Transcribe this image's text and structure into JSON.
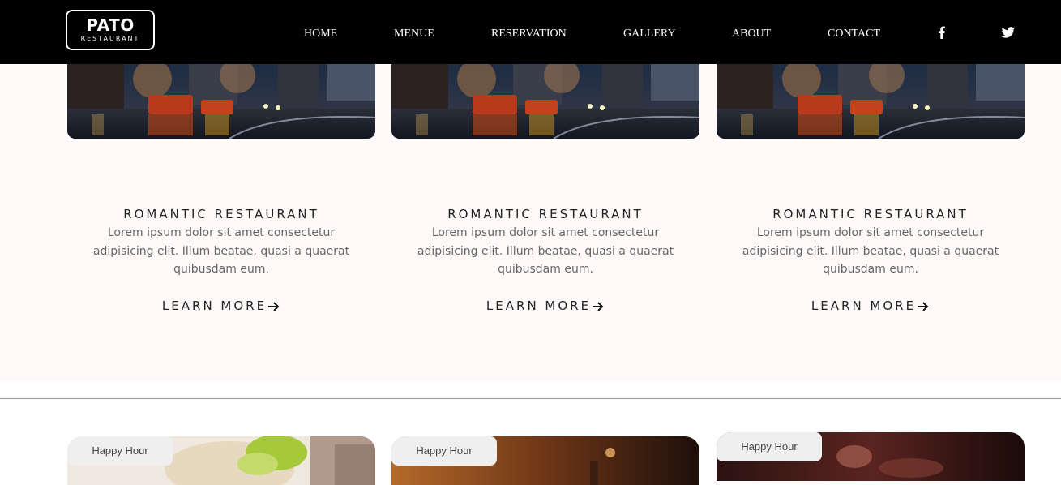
{
  "brand": {
    "name": "PATO",
    "sub": "RESTAURANT"
  },
  "nav": {
    "items": [
      {
        "label": "HOME"
      },
      {
        "label": "MENUE"
      },
      {
        "label": "RESERVATION"
      },
      {
        "label": "GALLERY"
      },
      {
        "label": "ABOUT"
      },
      {
        "label": "CONTACT"
      }
    ],
    "social": [
      "facebook-icon",
      "twitter-icon"
    ]
  },
  "cards": [
    {
      "title": "ROMANTIC RESTAURANT",
      "text": "Lorem ipsum dolor sit amet consectetur adipisicing elit. Illum beatae, quasi a quaerat quibusdam eum.",
      "link": "LEARN MORE"
    },
    {
      "title": "ROMANTIC RESTAURANT",
      "text": "Lorem ipsum dolor sit amet consectetur adipisicing elit. Illum beatae, quasi a quaerat quibusdam eum.",
      "link": "LEARN MORE"
    },
    {
      "title": "ROMANTIC RESTAURANT",
      "text": "Lorem ipsum dolor sit amet consectetur adipisicing elit. Illum beatae, quasi a quaerat quibusdam eum.",
      "link": "LEARN MORE"
    }
  ],
  "happy_hour": [
    {
      "badge": "Happy Hour"
    },
    {
      "badge": "Happy Hour"
    },
    {
      "badge": "Happy Hour"
    }
  ],
  "colors": {
    "header_bg": "#000000",
    "section_bg": "#fffaf9",
    "text_dark": "#222222",
    "text_muted": "#666666"
  }
}
